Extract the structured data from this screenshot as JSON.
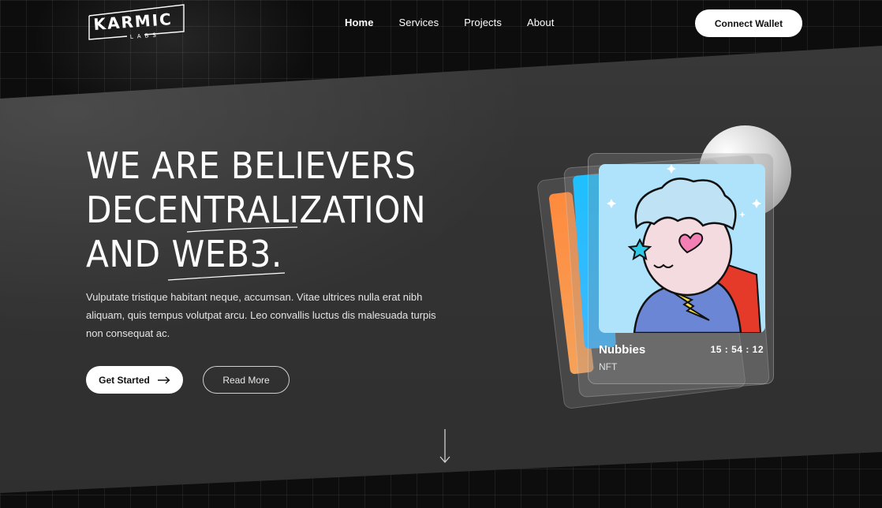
{
  "header": {
    "logo_top": "KARMIC",
    "logo_bottom": "LABS",
    "nav": [
      {
        "label": "Home"
      },
      {
        "label": "Services"
      },
      {
        "label": "Projects"
      },
      {
        "label": "About"
      }
    ],
    "connect_label": "Connect Wallet"
  },
  "hero": {
    "title_lines": [
      "WE ARE BELIEVERS",
      "DECENTRALIZATION",
      "AND WEB3."
    ],
    "description": "Vulputate tristique habitant neque, accumsan. Vitae ultrices nulla erat nibh aliquam, quis tempus volutpat arcu. Leo convallis luctus dis malesuada turpis non consequat ac.",
    "primary_label": "Get Started",
    "secondary_label": "Read More"
  },
  "nft_card": {
    "name": "Nubbies",
    "timer": "15 : 54 : 12",
    "type": "NFT"
  },
  "icons": {
    "arrow": "arrow-right-icon",
    "scroll": "arrow-down-icon"
  },
  "colors": {
    "background": "#0d0d0d",
    "band": "#333333",
    "accent": "#ffffff",
    "nft_bg": "#aee3fb"
  }
}
